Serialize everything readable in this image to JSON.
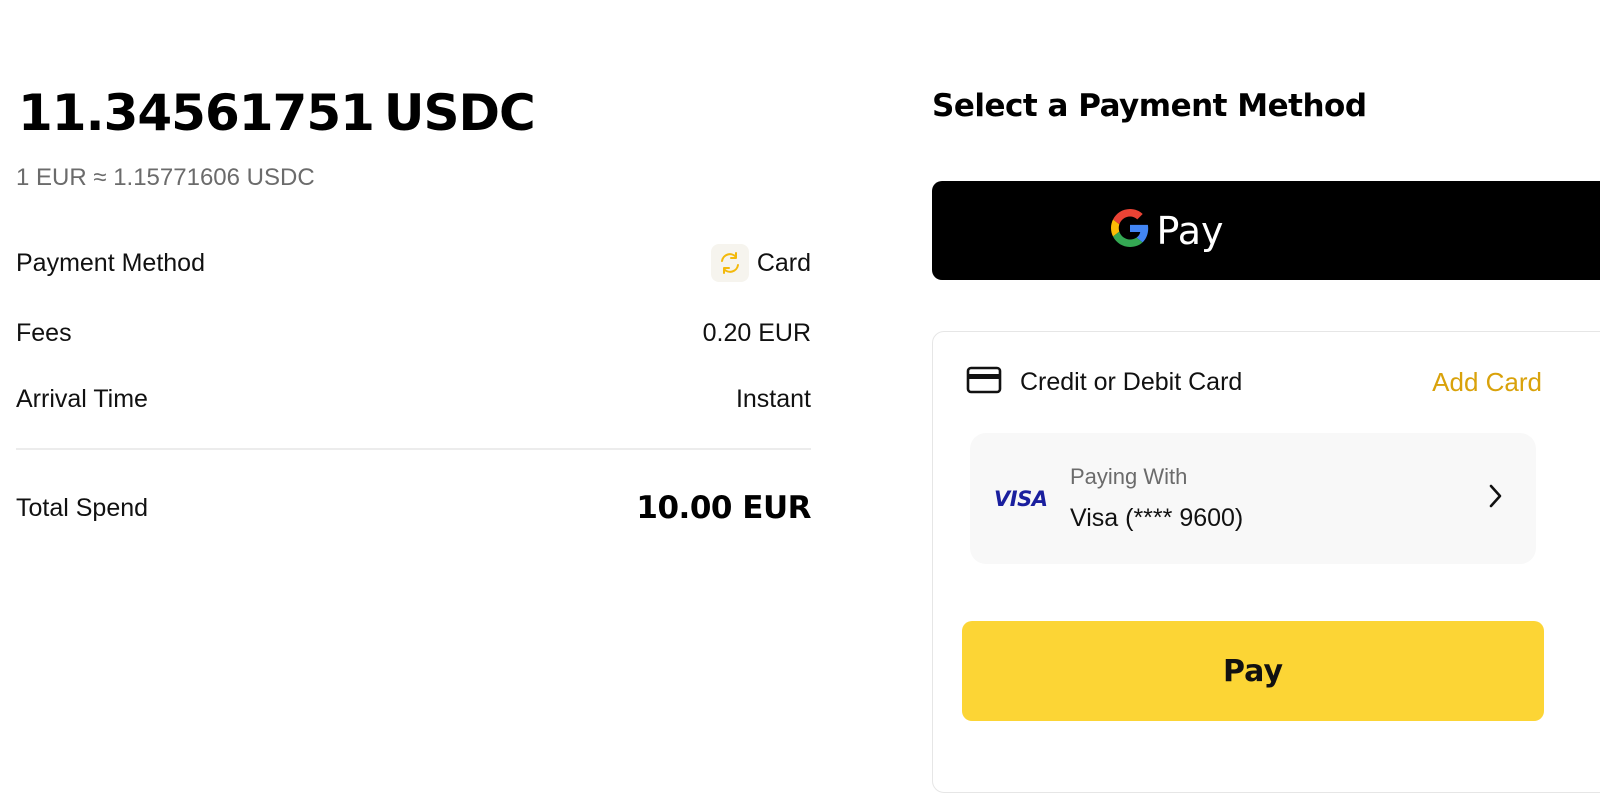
{
  "summary": {
    "amount": "11.34561751",
    "currency": "USDC",
    "rate": "1 EUR ≈ 1.15771606 USDC",
    "payment_method_label": "Payment Method",
    "payment_method_value": "Card",
    "fees_label": "Fees",
    "fees_value": "0.20 EUR",
    "arrival_label": "Arrival Time",
    "arrival_value": "Instant",
    "total_label": "Total Spend",
    "total_value": "10.00 EUR"
  },
  "payment": {
    "title": "Select a Payment Method",
    "gpay_label": "Pay",
    "card_section_label": "Credit or Debit Card",
    "add_card_label": "Add Card",
    "paying_with_label": "Paying With",
    "card_brand": "VISA",
    "card_name": "Visa (**** 9600)",
    "pay_button_label": "Pay"
  },
  "colors": {
    "accent_yellow": "#fcd535",
    "add_card_text": "#d9a20b",
    "visa_blue": "#1a1f9e",
    "muted_text": "#6b6b6b"
  },
  "icons": {
    "card_method": "card-refresh-icon",
    "google_pay": "google-g-icon",
    "credit_card": "credit-card-icon",
    "chevron": "chevron-right-icon"
  }
}
